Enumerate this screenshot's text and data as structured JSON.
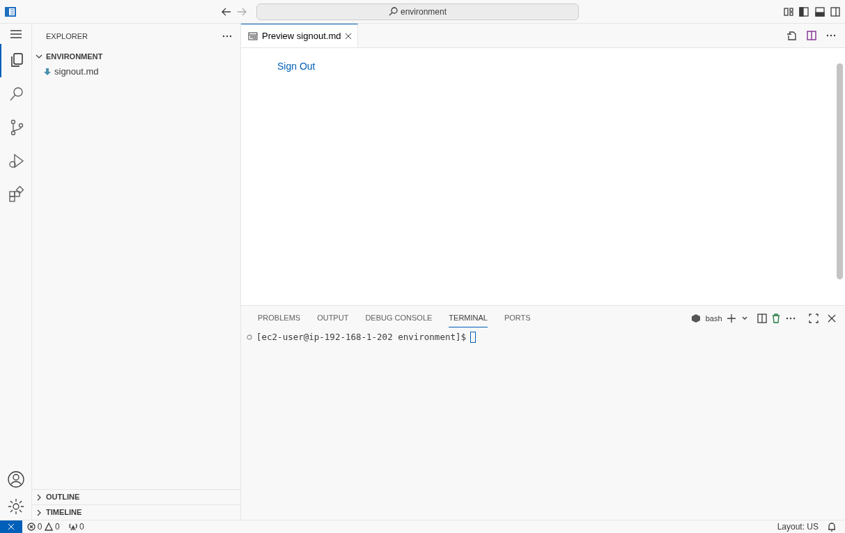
{
  "title_bar": {
    "search": "environment"
  },
  "activity_bar": [
    {
      "kind": "explorer",
      "selected": true
    },
    {
      "kind": "search",
      "selected": false
    },
    {
      "kind": "scm",
      "selected": false
    },
    {
      "kind": "debug",
      "selected": false
    },
    {
      "kind": "extensions",
      "selected": false
    }
  ],
  "sidebar": {
    "title": "EXPLORER",
    "sections": [
      {
        "label": "ENVIRONMENT",
        "expanded": true,
        "files": [
          "signout.md"
        ]
      },
      {
        "label": "OUTLINE",
        "expanded": false
      },
      {
        "label": "TIMELINE",
        "expanded": false
      }
    ]
  },
  "editor": {
    "tabs": [
      {
        "label": "Preview signout.md",
        "selected": true
      }
    ],
    "preview_link": "Sign Out"
  },
  "panel": {
    "tabs": [
      {
        "label": "PROBLEMS",
        "selected": false
      },
      {
        "label": "OUTPUT",
        "selected": false
      },
      {
        "label": "DEBUG CONSOLE",
        "selected": false
      },
      {
        "label": "TERMINAL",
        "selected": true
      },
      {
        "label": "PORTS",
        "selected": false
      }
    ],
    "profile": "bash",
    "prompt": "[ec2-user@ip-192-168-1-202 environment]$"
  },
  "status_bar": {
    "errors": "0",
    "warnings": "0",
    "ports": "0",
    "layout": "Layout: US"
  }
}
